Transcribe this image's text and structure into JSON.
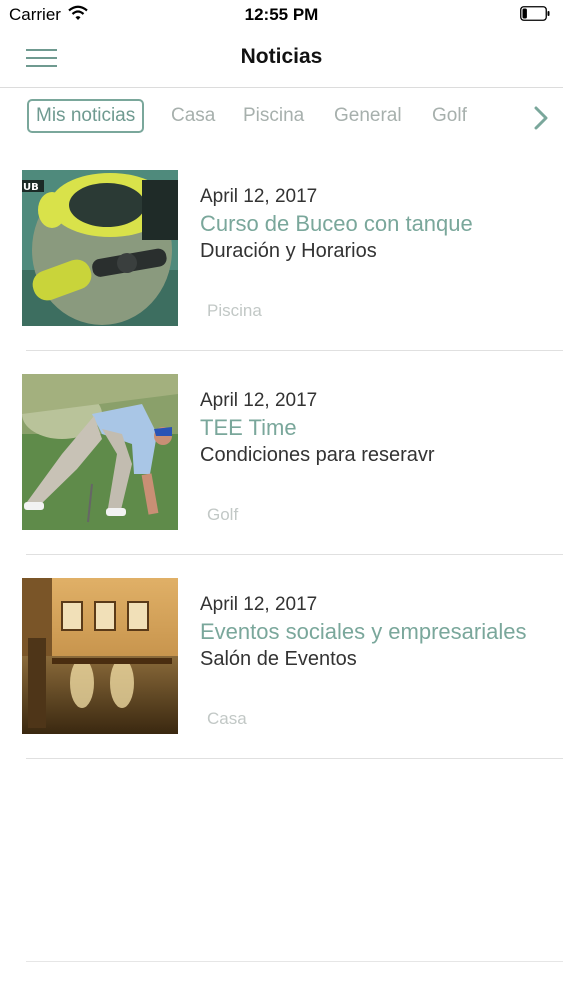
{
  "status_bar": {
    "carrier": "Carrier",
    "time": "12:55 PM",
    "battery_level": 0.2
  },
  "nav": {
    "title": "Noticias",
    "menu_icon": "hamburger-menu-icon"
  },
  "tabs": [
    {
      "label": "Mis noticias",
      "active": true
    },
    {
      "label": "Casa",
      "active": false
    },
    {
      "label": "Piscina",
      "active": false
    },
    {
      "label": "General",
      "active": false
    },
    {
      "label": "Golf",
      "active": false
    }
  ],
  "tabs_next_icon": "chevron-right-icon",
  "accent_color": "#7aa79b",
  "news": [
    {
      "date": "April 12, 2017",
      "title": "Curso de Buceo con tanque",
      "subtitle": "Duración y Horarios",
      "category": "Piscina",
      "image": "diver-photo"
    },
    {
      "date": "April 12, 2017",
      "title": "TEE Time",
      "subtitle": "Condiciones para reseravr",
      "category": "Golf",
      "image": "golfer-photo"
    },
    {
      "date": "April 12, 2017",
      "title": "Eventos sociales y empresariales",
      "subtitle": "Salón de Eventos",
      "category": "Casa",
      "image": "event-hall-photo"
    }
  ]
}
